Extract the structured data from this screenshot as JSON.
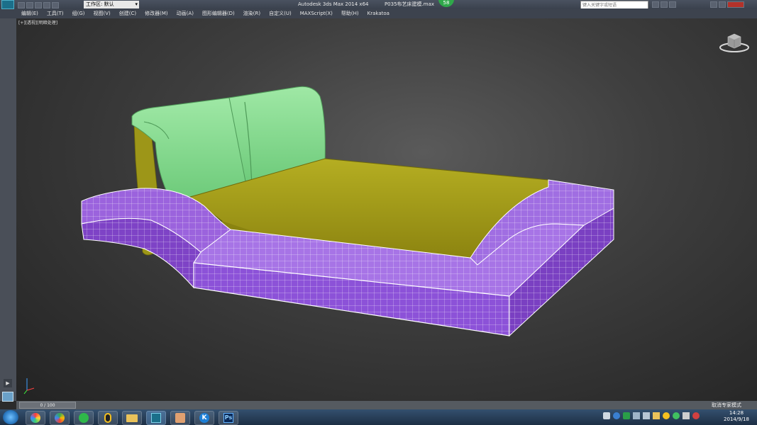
{
  "app": {
    "title": "Autodesk 3ds Max  2014 x64",
    "file": "P035布艺床建模.max",
    "workspace_label": "工作区: 默认",
    "search_placeholder": "键入关键字或短语",
    "badge": "58"
  },
  "menu": [
    "编辑(E)",
    "工具(T)",
    "组(G)",
    "视图(V)",
    "创建(C)",
    "修改器(M)",
    "动画(A)",
    "图形编辑器(D)",
    "渲染(R)",
    "自定义(U)",
    "MAXScript(X)",
    "帮助(H)",
    "Krakatoa"
  ],
  "viewport": {
    "label_plus": "[+]",
    "label_view": "[透视]",
    "label_shade": "[明暗处理]"
  },
  "timeline": {
    "frame_text": "0 / 100"
  },
  "status": {
    "text": "取消专家模式"
  },
  "taskbar": {
    "time": "14:28",
    "date": "2014/9/18",
    "apps": [
      "browser-icon",
      "browser2-icon",
      "folder-icon",
      "qq-icon",
      "explorer-icon",
      "3dsmax-icon",
      "image-icon",
      "k-icon",
      "ps-icon"
    ],
    "ps_label": "Ps",
    "k_label": "K"
  },
  "colors": {
    "mattress": "#a8a21a",
    "headboard": "#7fd88a",
    "frame": "#8a4fd0",
    "wire": "#ffffff"
  }
}
